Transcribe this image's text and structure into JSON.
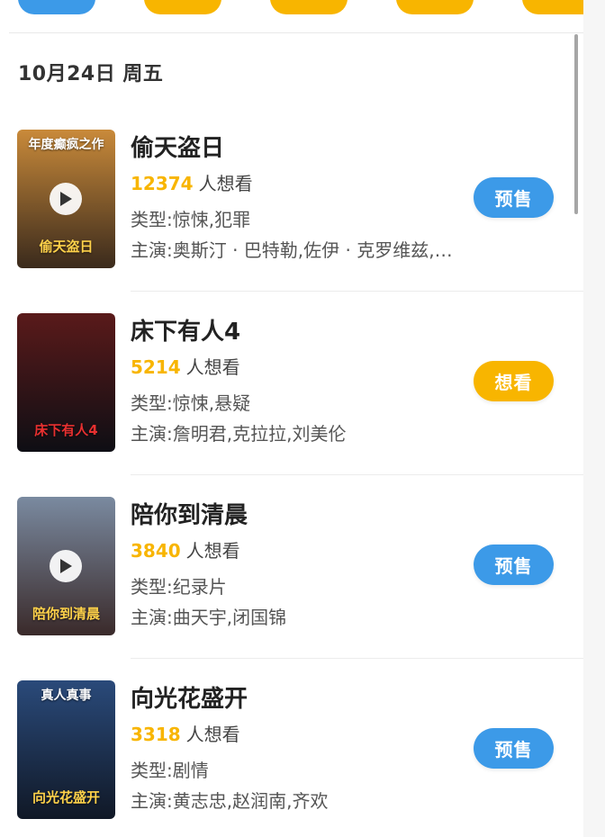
{
  "colors": {
    "accent_blue": "#3c9ae8",
    "accent_yellow": "#f8b500"
  },
  "date_header": "10月24日 周五",
  "want_suffix": "人想看",
  "movies": [
    {
      "title": "偷天盗日",
      "want_count": "12374",
      "genre": "类型:惊悚,犯罪",
      "cast": "主演:奥斯汀 · 巴特勒,佐伊 · 克罗维兹,…",
      "button_label": "预售",
      "button_color": "#3c9ae8",
      "has_trailer": true,
      "poster_text_top": "年度癫疯之作",
      "poster_text_bottom": "偷天盗日",
      "poster_colors": [
        "#c98a3a",
        "#3a2a1c"
      ]
    },
    {
      "title": "床下有人4",
      "want_count": "5214",
      "genre": "类型:惊悚,悬疑",
      "cast": "主演:詹明君,克拉拉,刘美伦",
      "button_label": "想看",
      "button_color": "#f8b500",
      "has_trailer": false,
      "poster_text_top": "",
      "poster_text_bottom": "床下有人4",
      "poster_colors": [
        "#5a1a1a",
        "#0e0e14"
      ]
    },
    {
      "title": "陪你到清晨",
      "want_count": "3840",
      "genre": "类型:纪录片",
      "cast": "主演:曲天宇,闭国锦",
      "button_label": "预售",
      "button_color": "#3c9ae8",
      "has_trailer": true,
      "poster_text_top": "",
      "poster_text_bottom": "陪你到清晨",
      "poster_colors": [
        "#7a8aa0",
        "#3a2a2a"
      ]
    },
    {
      "title": "向光花盛开",
      "want_count": "3318",
      "genre": "类型:剧情",
      "cast": "主演:黄志忠,赵润南,齐欢",
      "button_label": "预售",
      "button_color": "#3c9ae8",
      "has_trailer": false,
      "poster_text_top": "真人真事",
      "poster_text_bottom": "向光花盛开",
      "poster_colors": [
        "#2a4a7a",
        "#101826"
      ]
    }
  ]
}
